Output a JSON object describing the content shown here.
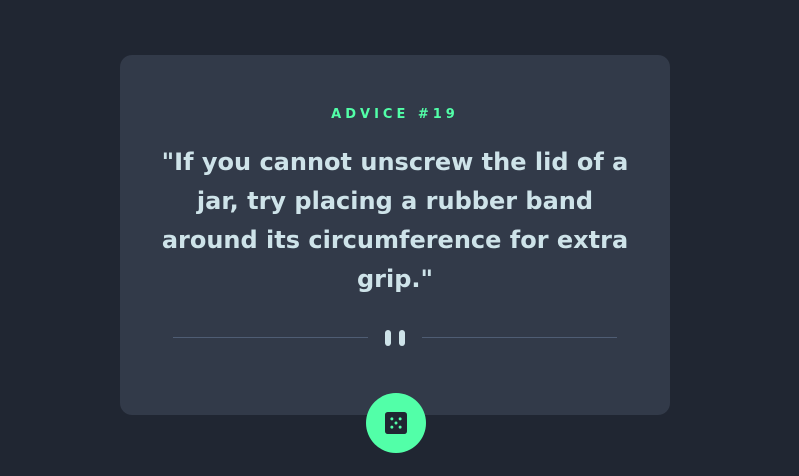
{
  "advice": {
    "id_label": "ADVICE #19",
    "text": "\"If you cannot unscrew the lid of a jar, try placing a rubber band around its circumference for extra grip.\""
  },
  "icons": {
    "divider": "pause-icon",
    "button": "dice-icon"
  },
  "colors": {
    "background": "#202632",
    "card": "#323a49",
    "accent": "#52ffa8",
    "text": "#cee3e9",
    "divider": "#4f5d74"
  }
}
